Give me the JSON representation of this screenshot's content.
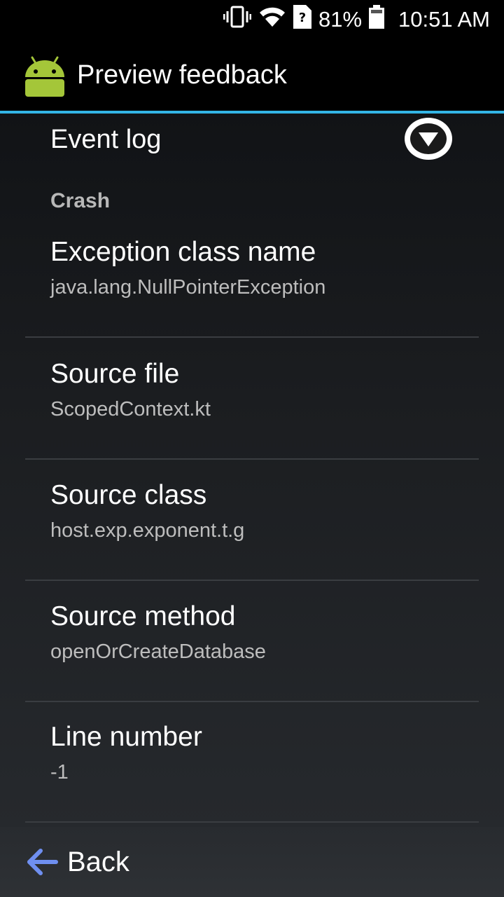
{
  "status_bar": {
    "battery_percent": "81%",
    "time": "10:51 AM",
    "icons": [
      "vibrate-icon",
      "wifi-icon",
      "unknown-sim-icon",
      "battery-icon"
    ]
  },
  "app_bar": {
    "title": "Preview feedback",
    "icon": "android-icon"
  },
  "event_log": {
    "label": "Event log",
    "expand_icon": "chevron-down-circle-icon"
  },
  "section": {
    "header": "Crash"
  },
  "items": [
    {
      "label": "Exception class name",
      "value": "java.lang.NullPointerException"
    },
    {
      "label": "Source file",
      "value": "ScopedContext.kt"
    },
    {
      "label": "Source class",
      "value": "host.exp.exponent.t.g"
    },
    {
      "label": "Source method",
      "value": "openOrCreateDatabase"
    },
    {
      "label": "Line number",
      "value": "-1"
    }
  ],
  "footer": {
    "back_label": "Back",
    "back_icon": "back-arrow-icon"
  },
  "colors": {
    "accent": "#33b5e5",
    "back_arrow": "#6f8ff0",
    "android_green": "#a4c639"
  }
}
